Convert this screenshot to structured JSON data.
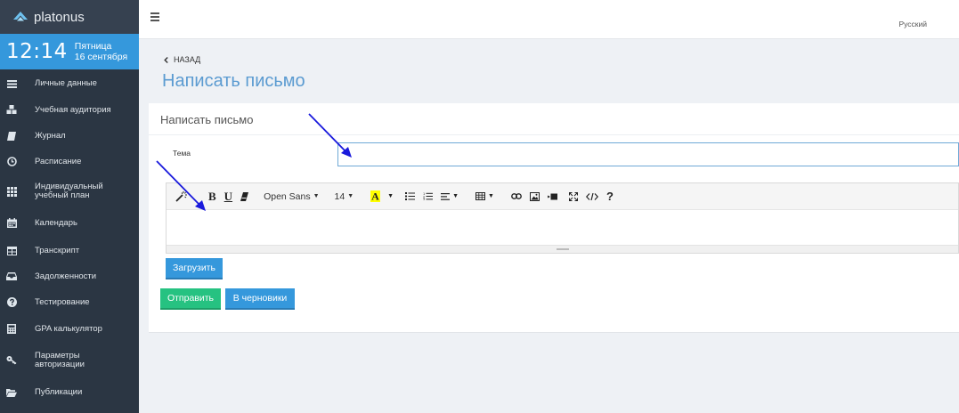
{
  "app": {
    "brand": "platonus"
  },
  "clock": {
    "time": "12:14",
    "weekday": "Пятница",
    "date": "16 сентября"
  },
  "sidebar": {
    "items": [
      {
        "label": "Личные данные",
        "icon": "list-icon"
      },
      {
        "label": "Учебная аудитория",
        "icon": "cubes-icon"
      },
      {
        "label": "Журнал",
        "icon": "book-icon"
      },
      {
        "label": "Расписание",
        "icon": "clock-icon"
      },
      {
        "label": "Индивидуальный учебный план",
        "icon": "grid-icon"
      },
      {
        "label": "Календарь",
        "icon": "calendar-icon"
      },
      {
        "label": "Транскрипт",
        "icon": "table-icon"
      },
      {
        "label": "Задолженности",
        "icon": "inbox-icon"
      },
      {
        "label": "Тестирование",
        "icon": "question-icon"
      },
      {
        "label": "GPA калькулятор",
        "icon": "calculator-icon"
      },
      {
        "label": "Параметры авторизации",
        "icon": "key-icon"
      },
      {
        "label": "Публикации",
        "icon": "folder-open-icon"
      }
    ]
  },
  "topbar": {
    "language": "Русский"
  },
  "header": {
    "back_label": "НАЗАД",
    "page_title": "Написать письмо"
  },
  "form": {
    "card_title": "Написать письмо",
    "subject_label": "Тема",
    "subject_value": "",
    "editor": {
      "font_name": "Open Sans",
      "font_size": "14",
      "body": ""
    },
    "upload_label": "Загрузить",
    "send_label": "Отправить",
    "draft_label": "В черновики"
  },
  "colors": {
    "sidebar": "#2b3643",
    "accent": "#3598dc",
    "success": "#26c281",
    "title": "#5b9bd1",
    "annotation_arrow": "#1a1adc"
  }
}
